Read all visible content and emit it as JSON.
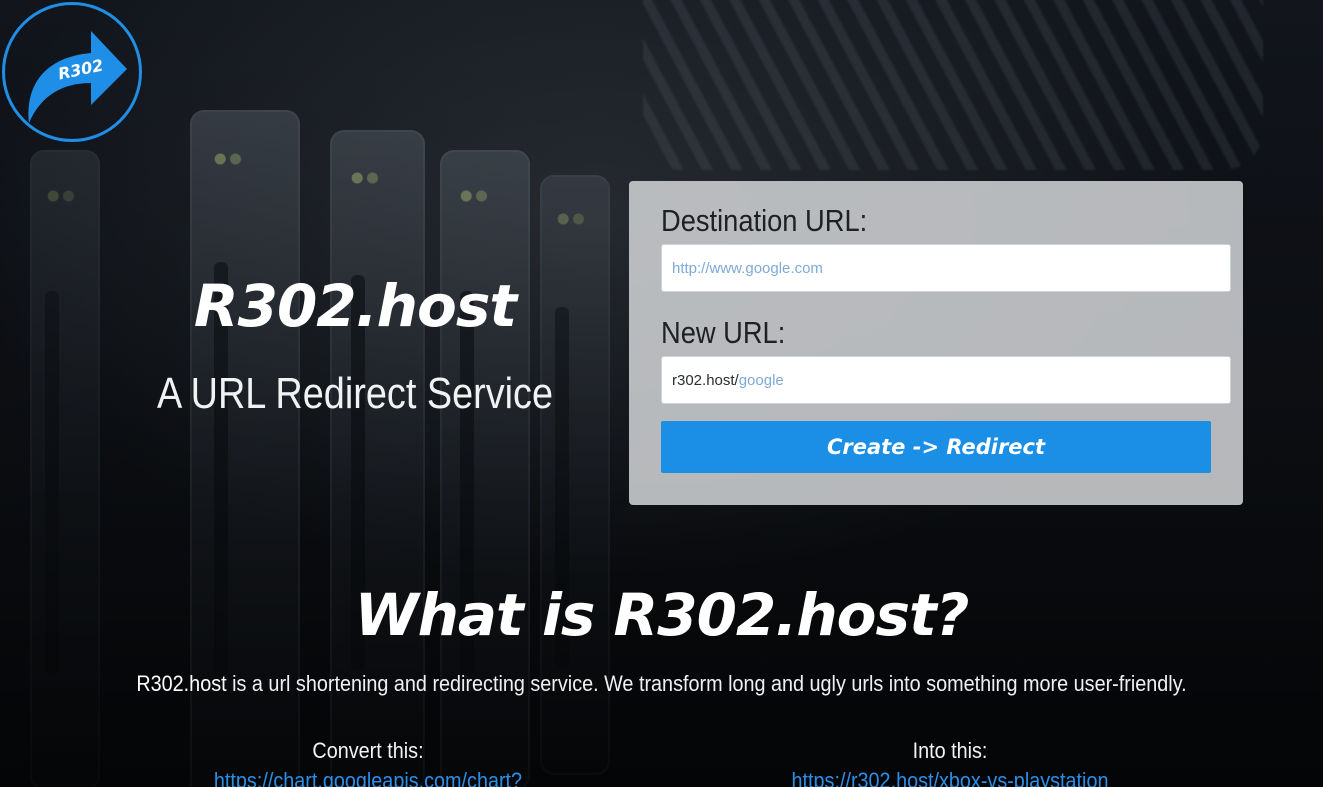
{
  "logo": {
    "text": "R302",
    "icon": "curved-arrow-icon",
    "ring_color": "#1e8ee6"
  },
  "hero": {
    "title": "R302.host",
    "subtitle": "A URL Redirect Service"
  },
  "form": {
    "destination_label": "Destination URL:",
    "destination_placeholder": "http://www.google.com",
    "destination_value": "",
    "new_url_label": "New URL:",
    "new_url_prefix": "r302.host/",
    "new_url_slug_placeholder": "google",
    "submit_label": "Create -> Redirect",
    "accent_color": "#1b8fe6"
  },
  "about": {
    "title": "What is R302.host?",
    "brand": "R302.host",
    "description": " is a url shortening and redirecting service. We transform long and ugly urls into something more user-friendly.",
    "convert_heading": "Convert this:",
    "convert_link": "https://chart.googleapis.com/chart?",
    "into_heading": "Into this:",
    "into_link": "https://r302.host/xbox-vs-playstation",
    "link_color": "#2b8fe8"
  }
}
